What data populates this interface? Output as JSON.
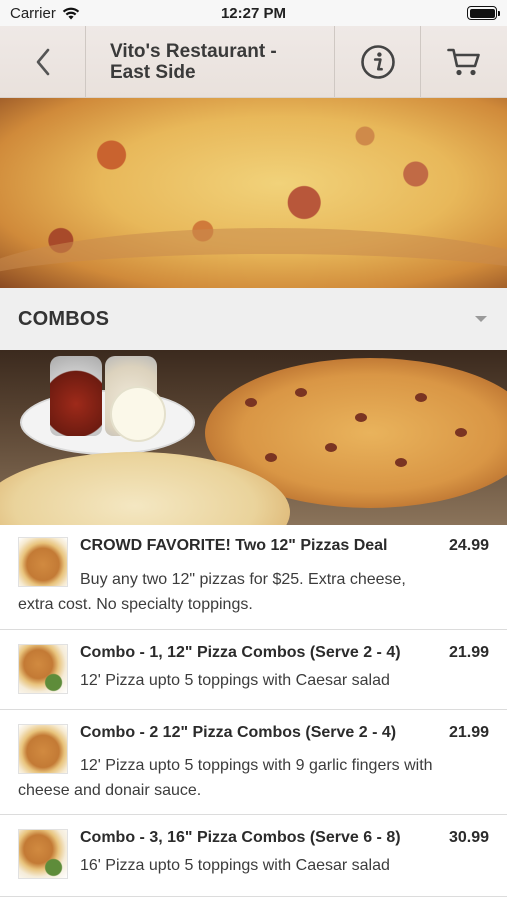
{
  "status_bar": {
    "carrier": "Carrier",
    "time": "12:27 PM"
  },
  "nav": {
    "title_line1": "Vito's Restaurant -",
    "title_line2": "East Side"
  },
  "section": {
    "title": "COMBOS"
  },
  "items": [
    {
      "name": "CROWD FAVORITE! Two 12\" Pizzas Deal",
      "price": "24.99",
      "desc": "Buy any two 12\" pizzas for $25. Extra cheese, extra cost. No specialty toppings."
    },
    {
      "name": "Combo - 1, 12\" Pizza Combos (Serve 2 - 4)",
      "price": "21.99",
      "desc": "12' Pizza upto 5 toppings with Caesar salad"
    },
    {
      "name": "Combo - 2 12\" Pizza Combos (Serve 2 - 4)",
      "price": "21.99",
      "desc": "12' Pizza upto 5 toppings with 9 garlic fingers with cheese and donair sauce."
    },
    {
      "name": "Combo - 3, 16\" Pizza Combos (Serve 6 - 8)",
      "price": "30.99",
      "desc": "16' Pizza upto 5 toppings with Caesar salad"
    }
  ],
  "icons": {
    "wifi": "wifi-icon",
    "battery": "battery-icon",
    "back": "chevron-left-icon",
    "info": "info-icon",
    "cart": "cart-icon",
    "caret": "caret-down-icon"
  },
  "colors": {
    "nav_bg": "#ece5e1",
    "section_bg": "#efefef",
    "text": "#2b2b2b",
    "divider": "#dcdcdc"
  }
}
